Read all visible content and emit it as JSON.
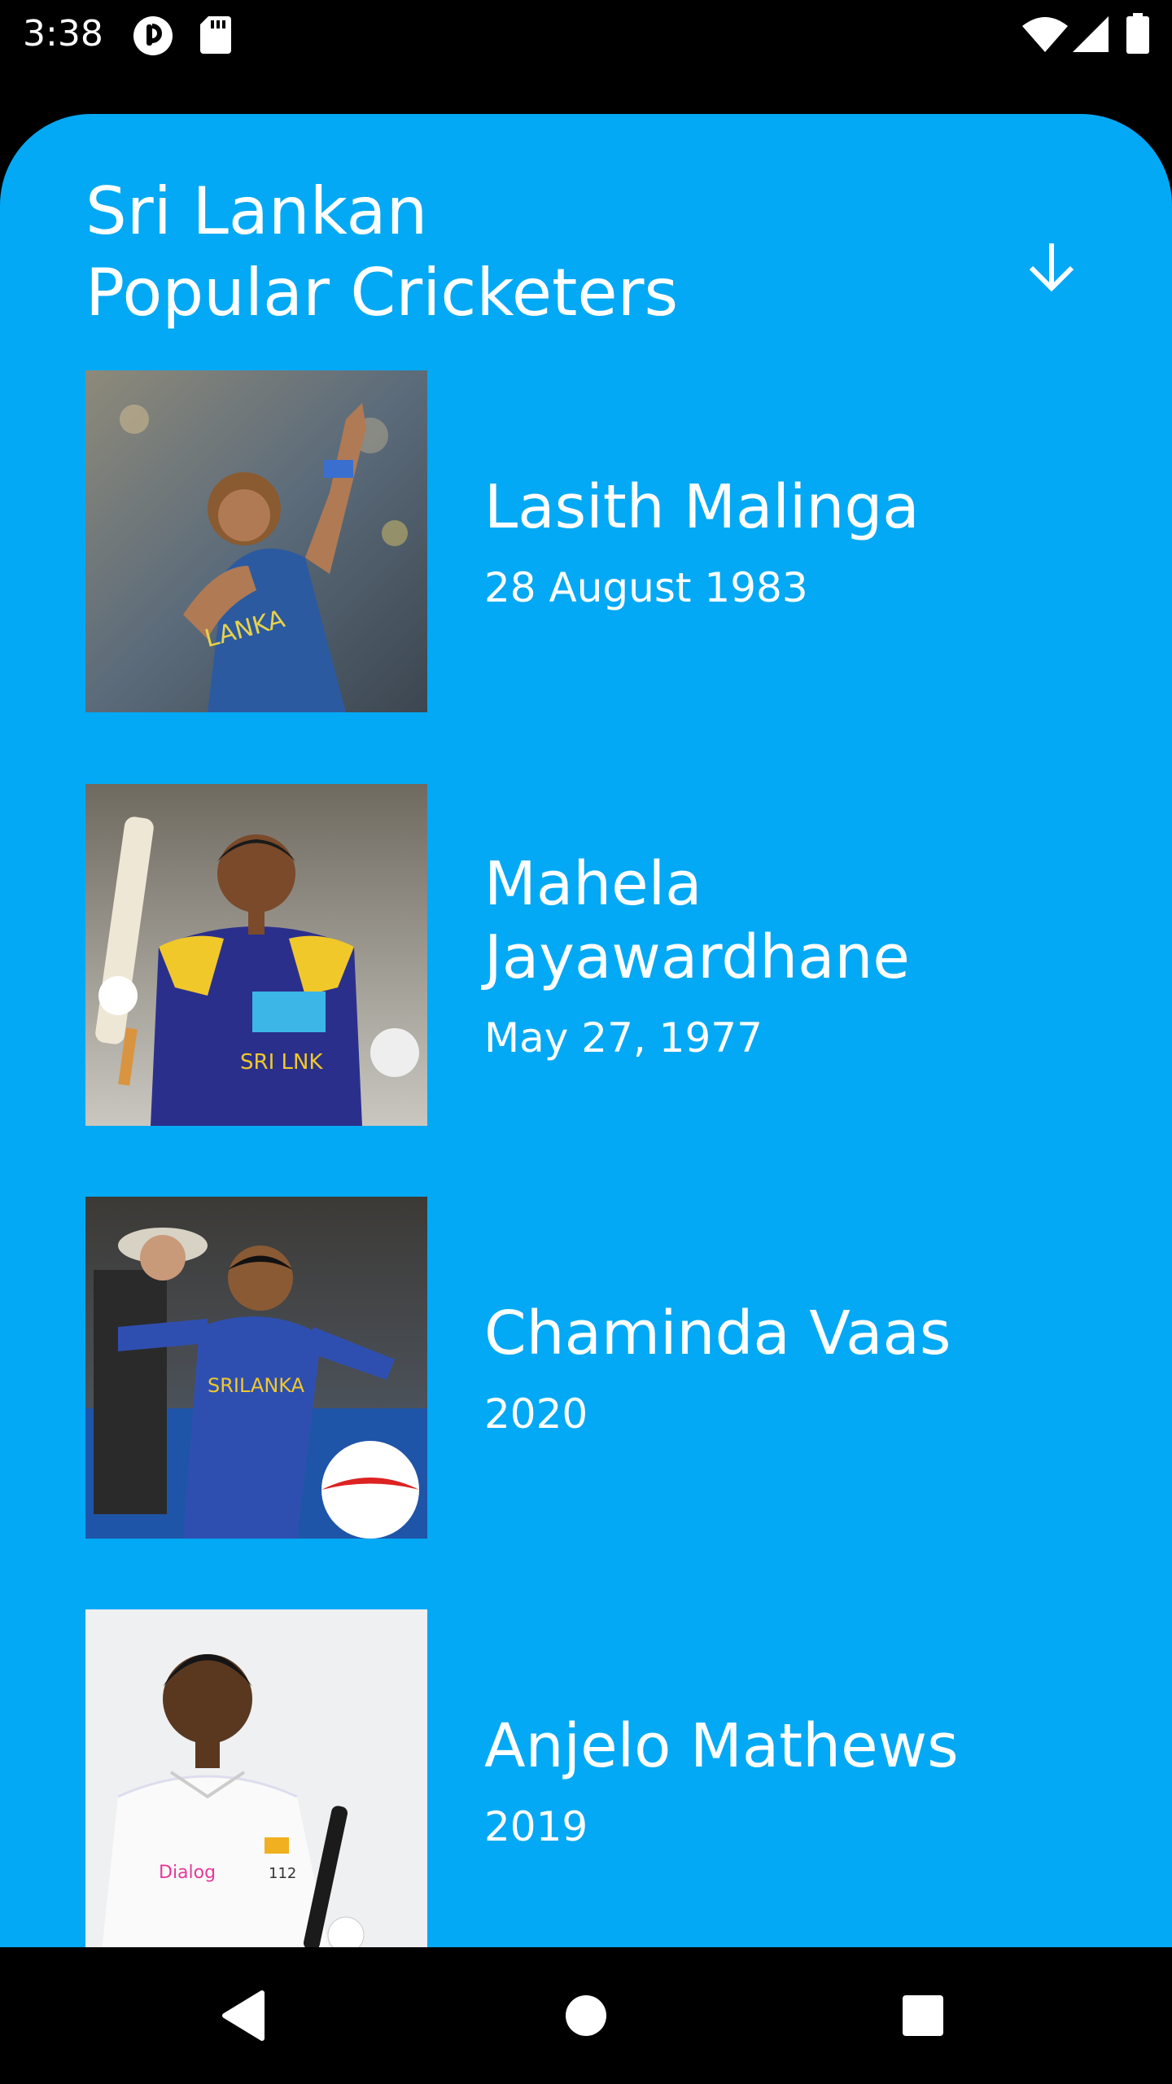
{
  "status_bar": {
    "time": "3:38",
    "icons": [
      "notification-circle-icon",
      "sd-card-icon",
      "wifi-icon",
      "signal-icon",
      "battery-icon"
    ]
  },
  "colors": {
    "accent": "#03A9F4",
    "text": "#FFFFFF",
    "system_bar": "#000000"
  },
  "header": {
    "title_line1": "Sri Lankan",
    "title_line2": "Popular Cricketers",
    "sort_icon": "arrow-down-icon"
  },
  "players": [
    {
      "name": "Lasith Malinga",
      "date": "28 August 1983"
    },
    {
      "name": "Mahela Jayawardhane",
      "date": "May 27, 1977"
    },
    {
      "name": "Chaminda Vaas",
      "date": "2020"
    },
    {
      "name": "Anjelo Mathews",
      "date": "2019"
    }
  ],
  "nav_bar": {
    "back_icon": "back-triangle-icon",
    "home_icon": "home-circle-icon",
    "recents_icon": "recents-square-icon"
  }
}
